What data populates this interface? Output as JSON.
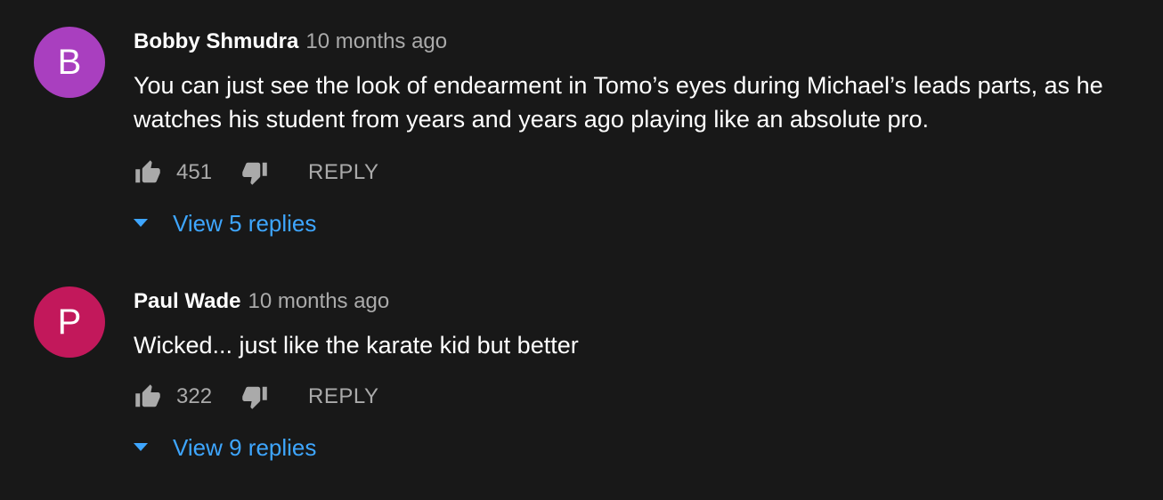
{
  "comments": [
    {
      "avatar_letter": "B",
      "avatar_color": "#a93fbf",
      "author": "Bobby Shmudra",
      "time": "10 months ago",
      "text": "You can just see the look of endearment in Tomo’s eyes during Michael’s leads parts, as he watches his student from years and years ago playing like an absolute pro.",
      "likes": "451",
      "reply_label": "REPLY",
      "view_replies_label": "View 5 replies"
    },
    {
      "avatar_letter": "P",
      "avatar_color": "#c2185b",
      "author": "Paul Wade",
      "time": "10 months ago",
      "text": "Wicked... just like the karate kid but better",
      "likes": "322",
      "reply_label": "REPLY",
      "view_replies_label": "View 9 replies"
    }
  ],
  "icons": {
    "like": "thumb-up-icon",
    "dislike": "thumb-down-icon",
    "expand": "caret-down-icon"
  },
  "colors": {
    "background": "#181818",
    "link": "#3ea6ff",
    "secondary_text": "#aaaaaa"
  }
}
